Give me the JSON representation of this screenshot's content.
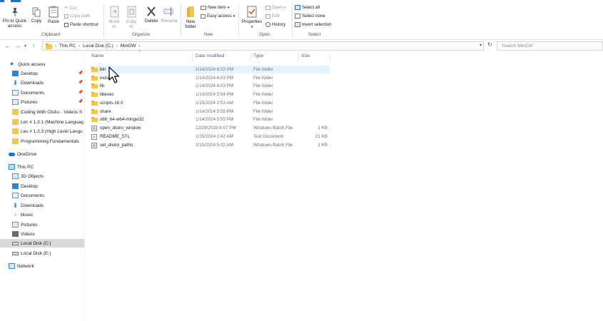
{
  "ribbon": {
    "clipboard": {
      "pin_label_1": "Pin to Quick",
      "pin_label_2": "access",
      "copy_label": "Copy",
      "paste_label": "Paste",
      "cut_label": "Cut",
      "copy_path_label": "Copy path",
      "paste_shortcut_label": "Paste shortcut",
      "group_label": "Clipboard"
    },
    "organize": {
      "move_to_1": "Move",
      "move_to_2": "to",
      "copy_to_1": "Copy",
      "copy_to_2": "to",
      "delete_label": "Delete",
      "rename_label": "Rename",
      "group_label": "Organize"
    },
    "new": {
      "new_item_label": "New item",
      "easy_access_label": "Easy access",
      "new_folder_1": "New",
      "new_folder_2": "folder",
      "group_label": "New"
    },
    "open": {
      "properties_label": "Properties",
      "open_label": "Open",
      "edit_label": "Edit",
      "history_label": "History",
      "group_label": "Open"
    },
    "select": {
      "select_all_label": "Select all",
      "select_none_label": "Select none",
      "invert_selection_label": "Invert selection",
      "group_label": "Select"
    }
  },
  "address": {
    "crumbs": [
      "This PC",
      "Local Disk (C:)",
      "MinGW"
    ],
    "search_placeholder": "Search MinGW"
  },
  "navpane": {
    "quick_access": "Quick access",
    "quick_items": [
      {
        "label": "Desktop",
        "pinned": true
      },
      {
        "label": "Downloads",
        "pinned": true
      },
      {
        "label": "Documents",
        "pinned": true
      },
      {
        "label": "Pictures",
        "pinned": true
      },
      {
        "label": "Coding With Clicks - Videos S"
      },
      {
        "label": "Lec # 1.3.1 (Machine Languag"
      },
      {
        "label": "Lec # 1.3.3 (High Level Langu"
      },
      {
        "label": "Programming Fundamentals"
      }
    ],
    "onedrive": "OneDrive",
    "this_pc": "This PC",
    "pc_items": [
      "3D Objects",
      "Desktop",
      "Documents",
      "Downloads",
      "Music",
      "Pictures",
      "Videos",
      "Local Disk (C:)",
      "Local Disk (E:)"
    ],
    "network": "Network"
  },
  "columns": {
    "name": "Name",
    "date": "Date modified",
    "type": "Type",
    "size": "Size"
  },
  "files": [
    {
      "name": "bin",
      "date": "1/14/2024 6:03 PM",
      "type": "File folder",
      "size": "",
      "kind": "folder"
    },
    {
      "name": "inclu",
      "date": "1/14/2024 6:03 PM",
      "type": "File folder",
      "size": "",
      "kind": "folder"
    },
    {
      "name": "lib",
      "date": "1/14/2024 6:03 PM",
      "type": "File folder",
      "size": "",
      "kind": "folder"
    },
    {
      "name": "libexec",
      "date": "1/14/2024 5:54 PM",
      "type": "File folder",
      "size": "",
      "kind": "folder"
    },
    {
      "name": "scripts-16.0",
      "date": "1/15/2024 2:53 AM",
      "type": "File folder",
      "size": "",
      "kind": "folder"
    },
    {
      "name": "share",
      "date": "1/14/2024 5:55 PM",
      "type": "File folder",
      "size": "",
      "kind": "folder"
    },
    {
      "name": "x86_64-w64-mingw32",
      "date": "1/14/2024 5:55 PM",
      "type": "File folder",
      "size": "",
      "kind": "folder"
    },
    {
      "name": "open_distro_window",
      "date": "12/29/2018 6:07 PM",
      "type": "Windows Batch File",
      "size": "1 KB",
      "kind": "file"
    },
    {
      "name": "README_STL",
      "date": "1/15/2024 2:42 AM",
      "type": "Text Document",
      "size": "21 KB",
      "kind": "file"
    },
    {
      "name": "set_distro_paths",
      "date": "1/15/2024 5:02 AM",
      "type": "Windows Batch File",
      "size": "1 KB",
      "kind": "file"
    }
  ],
  "colors": {
    "accent": "#1e6fd0",
    "folder": "#f2c84b",
    "selection": "#d9d9d9",
    "hover": "#e5f3ff"
  }
}
